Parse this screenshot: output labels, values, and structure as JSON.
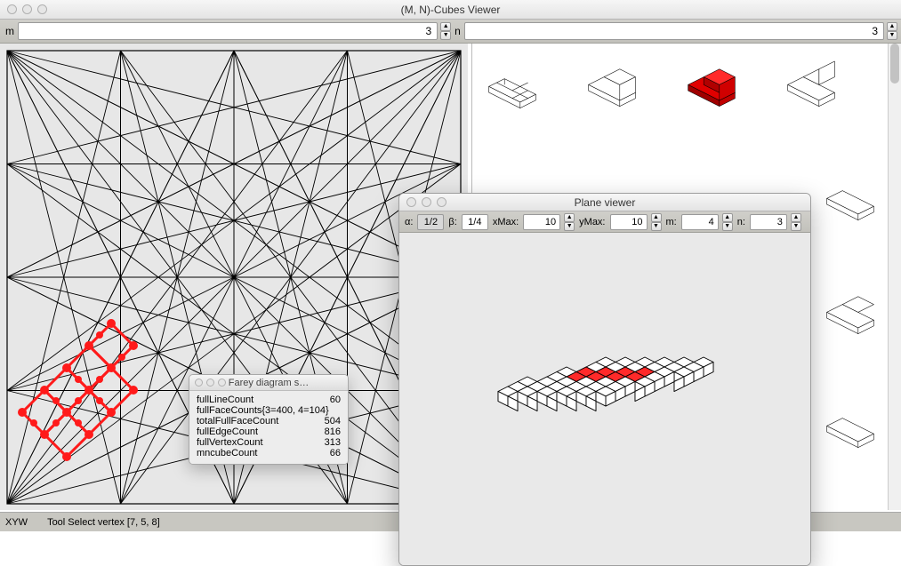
{
  "window": {
    "title": "(M, N)-Cubes Viewer"
  },
  "toolbar": {
    "m_label": "m",
    "m_value": "3",
    "n_label": "n",
    "n_value": "3"
  },
  "statusbar": {
    "mode": "XYW",
    "tool": "Tool Select vertex [7, 5, 8]"
  },
  "stats_window": {
    "title": "Farey diagram s…",
    "rows": [
      {
        "key": "fullLineCount",
        "val": "60"
      },
      {
        "key": "fullFaceCounts{3=400, 4=104}",
        "val": ""
      },
      {
        "key": "totalFullFaceCount",
        "val": "504"
      },
      {
        "key": "fullEdgeCount",
        "val": "816"
      },
      {
        "key": "fullVertexCount",
        "val": "313"
      },
      {
        "key": "mncubeCount",
        "val": "66"
      }
    ]
  },
  "plane_viewer": {
    "title": "Plane viewer",
    "alpha_label": "α:",
    "alpha_value": "1/2",
    "beta_label": "β:",
    "beta_value": "1/4",
    "xmax_label": "xMax:",
    "xmax_value": "10",
    "ymax_label": "yMax:",
    "ymax_value": "10",
    "m_label": "m:",
    "m_value": "4",
    "n_label": "n:",
    "n_value": "3"
  }
}
